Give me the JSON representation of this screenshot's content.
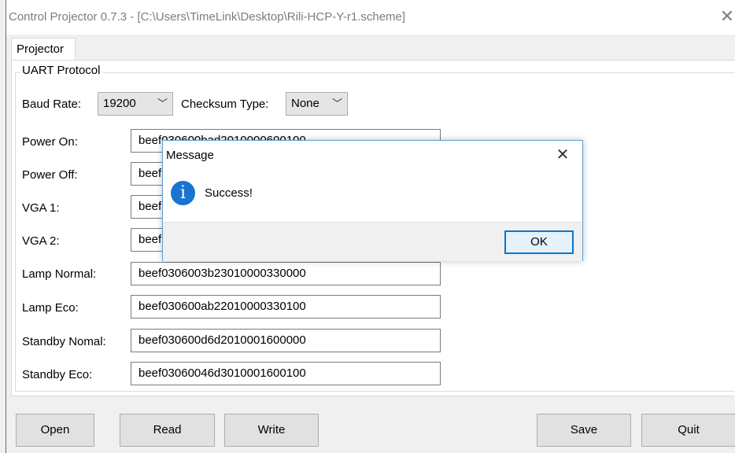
{
  "window": {
    "title": "Control Projector 0.7.3 - [C:\\Users\\TimeLink\\Desktop\\Rili-HCP-Y-r1.scheme]",
    "close_glyph": "✕"
  },
  "tabs": [
    {
      "label": "Projector"
    }
  ],
  "group": {
    "title": "UART Protocol"
  },
  "uart": {
    "baud_label": "Baud Rate:",
    "baud_value": "19200",
    "checksum_label": "Checksum Type:",
    "checksum_value": "None"
  },
  "commands": [
    {
      "label": "Power On:",
      "value": "beef030600bad2010000600100"
    },
    {
      "label": "Power Off:",
      "value": "beef"
    },
    {
      "label": "VGA 1:",
      "value": "beef"
    },
    {
      "label": "VGA 2:",
      "value": "beef"
    },
    {
      "label": "Lamp Normal:",
      "value": "beef0306003b23010000330000"
    },
    {
      "label": "Lamp Eco:",
      "value": "beef030600ab22010000330100"
    },
    {
      "label": "Standby Nomal:",
      "value": "beef030600d6d2010001600000"
    },
    {
      "label": "Standby Eco:",
      "value": "beef03060046d3010001600100"
    }
  ],
  "buttons": {
    "open": "Open",
    "read": "Read",
    "write": "Write",
    "save": "Save",
    "quit": "Quit"
  },
  "dialog": {
    "title": "Message",
    "message": "Success!",
    "ok": "OK",
    "close_glyph": "✕",
    "icon_glyph": "i"
  },
  "colors": {
    "dialog_border": "#5e9fd4",
    "info_icon": "#1a73d0",
    "ok_border": "#0078d7"
  }
}
